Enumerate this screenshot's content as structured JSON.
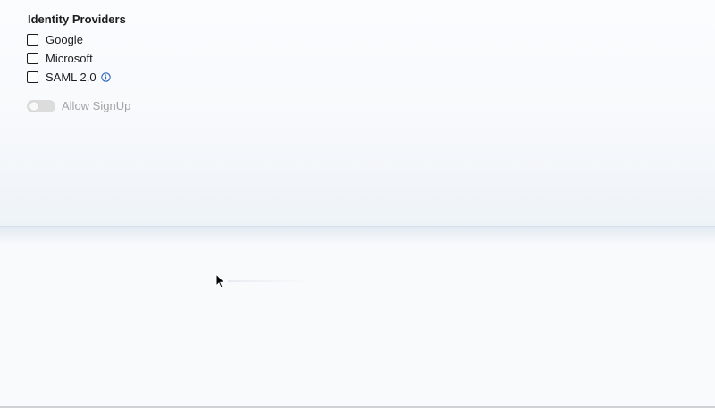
{
  "identity_providers": {
    "title": "Identity Providers",
    "options": [
      {
        "label": "Google",
        "checked": false
      },
      {
        "label": "Microsoft",
        "checked": false
      },
      {
        "label": "SAML 2.0",
        "checked": false,
        "icon": "info-icon"
      }
    ]
  },
  "signup": {
    "label": "Allow SignUp",
    "enabled": false,
    "disabled": true
  },
  "colors": {
    "info_icon": "#2a62b8",
    "toggle_track": "#dcdcdc",
    "disabled_text": "#a3a3a3"
  }
}
